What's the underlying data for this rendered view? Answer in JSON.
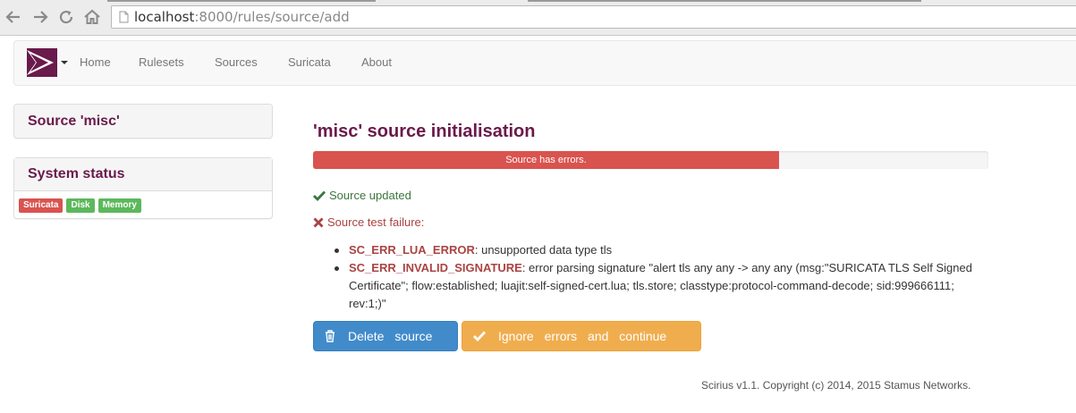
{
  "browser": {
    "url_host": "localhost",
    "url_rest": ":8000/rules/source/add",
    "back_icon": "back-arrow-icon",
    "forward_icon": "forward-arrow-icon",
    "reload_icon": "reload-icon",
    "home_icon": "home-icon"
  },
  "navbar": {
    "brand_icon": "scirius-logo-icon",
    "items": [
      "Home",
      "Rulesets",
      "Sources",
      "Suricata",
      "About"
    ]
  },
  "sidebar": {
    "source_panel_title": "Source 'misc'",
    "status_panel_title": "System status",
    "badges": [
      {
        "label": "Suricata",
        "status": "danger"
      },
      {
        "label": "Disk",
        "status": "success"
      },
      {
        "label": "Memory",
        "status": "success"
      }
    ]
  },
  "main": {
    "title": "'misc' source initialisation",
    "progress": {
      "value_percent": 69,
      "text": "Source has errors."
    },
    "updated_text": "Source updated",
    "failure_text": "Source test failure:",
    "errors": [
      {
        "code": "SC_ERR_LUA_ERROR",
        "message": ": unsupported data type tls"
      },
      {
        "code": "SC_ERR_INVALID_SIGNATURE",
        "message": ": error parsing signature \"alert tls any any -> any any (msg:\"SURICATA TLS Self Signed Certificate\"; flow:established; luajit:self-signed-cert.lua; tls.store; classtype:protocol-command-decode; sid:999666111; rev:1;)\""
      }
    ],
    "delete_button": "Delete source",
    "ignore_button": "Ignore errors and continue"
  },
  "footer": {
    "text": "Scirius v1.1. Copyright (c) 2014, 2015 Stamus Networks."
  },
  "colors": {
    "brand": "#6a1a4b",
    "danger": "#d9534f",
    "success": "#5cb85c",
    "primary": "#428bca",
    "warning": "#f0ad4e"
  }
}
